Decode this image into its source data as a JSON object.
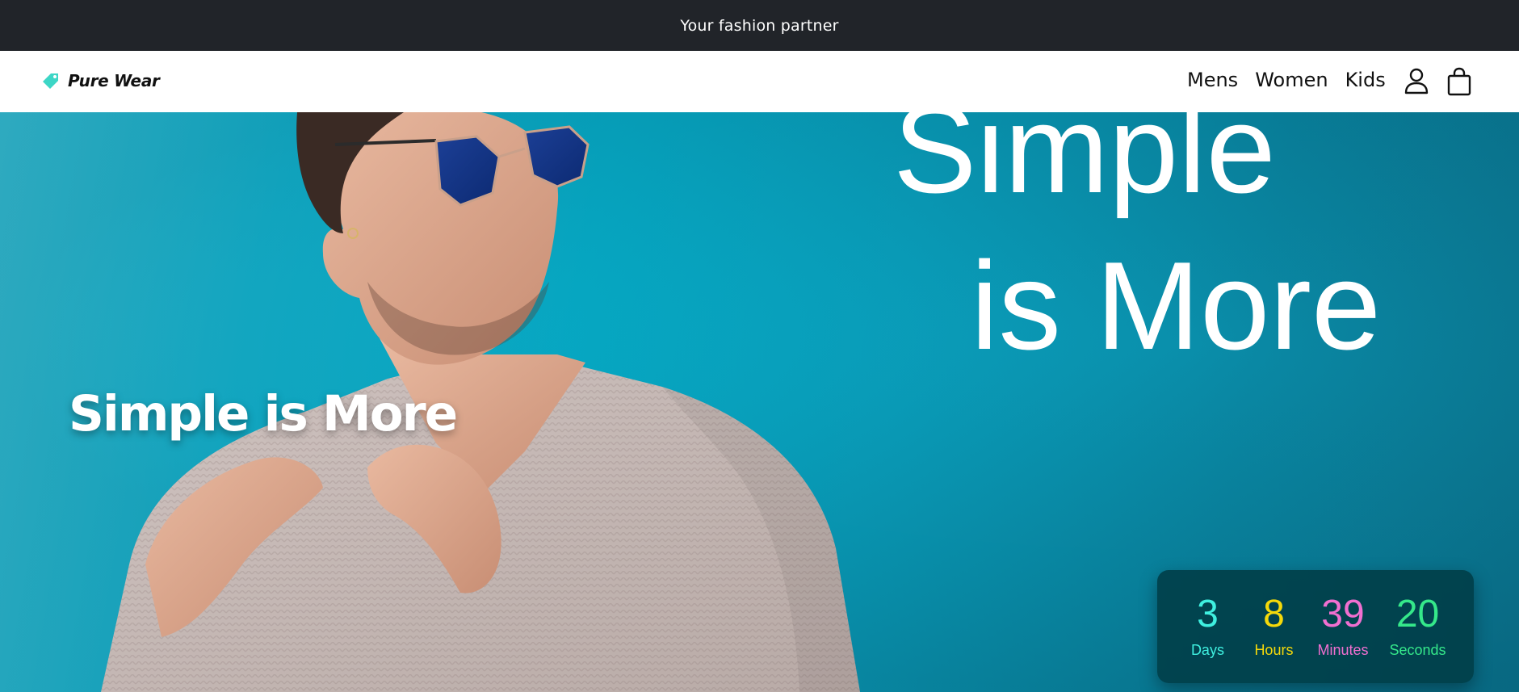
{
  "announcement": {
    "text": "Your fashion partner"
  },
  "brand": {
    "name": "Pure Wear",
    "icon": "tag-icon"
  },
  "nav": {
    "links": [
      {
        "label": "Mens"
      },
      {
        "label": "Women"
      },
      {
        "label": "Kids"
      }
    ],
    "icons": [
      "user-icon",
      "shopping-bag-icon"
    ]
  },
  "hero": {
    "headline_line1": "Simple",
    "headline_line2": "is More",
    "subheadline": "Simple is More"
  },
  "countdown": {
    "units": [
      {
        "value": "3",
        "label": "Days",
        "color": "#3ff0e0"
      },
      {
        "value": "8",
        "label": "Hours",
        "color": "#f5d90a"
      },
      {
        "value": "39",
        "label": "Minutes",
        "color": "#f06fd0"
      },
      {
        "value": "20",
        "label": "Seconds",
        "color": "#35e88a"
      }
    ]
  },
  "colors": {
    "topbar": "#212429",
    "hero_bg": "#07b8d4",
    "brand_accent": "#3dd6c6"
  }
}
